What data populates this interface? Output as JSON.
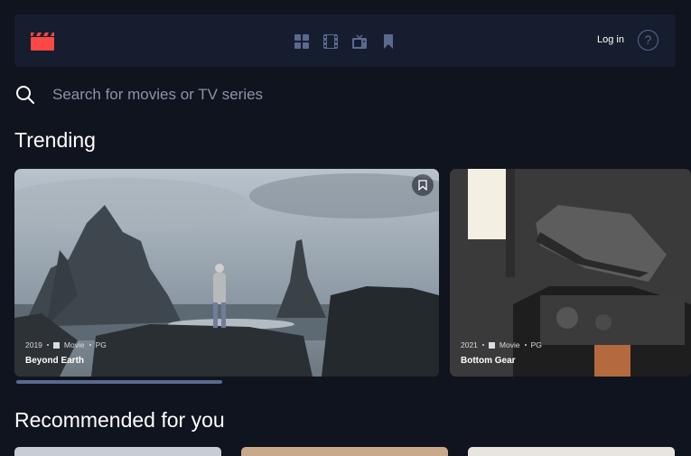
{
  "colors": {
    "background": "#10141e",
    "surface": "#161d2f",
    "accent": "#fc4747",
    "icon_muted": "#5a698f"
  },
  "nav": {
    "logo_icon": "film-clapper-icon",
    "items": [
      {
        "icon": "grid-icon",
        "name": "Home"
      },
      {
        "icon": "film-icon",
        "name": "Movies"
      },
      {
        "icon": "tv-icon",
        "name": "TV Series"
      },
      {
        "icon": "bookmark-icon",
        "name": "Bookmarked"
      }
    ],
    "login_label": "Log in",
    "help_label": "?"
  },
  "search": {
    "placeholder": "Search for movies or TV series",
    "value": ""
  },
  "trending": {
    "title": "Trending",
    "items": [
      {
        "year": "2019",
        "category": "Movie",
        "rating": "PG",
        "title": "Beyond Earth"
      },
      {
        "year": "2021",
        "category": "Movie",
        "rating": "PG",
        "title": "Bottom Gear"
      }
    ]
  },
  "recommended": {
    "title": "Recommended for you"
  }
}
